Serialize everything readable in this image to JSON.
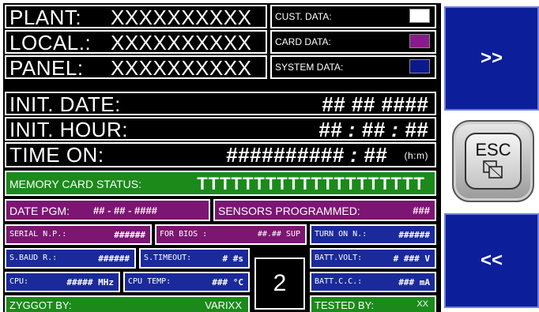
{
  "left": {
    "plant_label": "PLANT:",
    "plant_value": "XXXXXXXXXX",
    "local_label": "LOCAL.:",
    "local_value": "XXXXXXXXXX",
    "panel_label": "PANEL:",
    "panel_value": "XXXXXXXXXX",
    "cust_data_label": "CUST. DATA:",
    "card_data_label": "CARD DATA:",
    "system_data_label": "SYSTEM DATA:",
    "init_date_label": "INIT. DATE:",
    "init_date_value": "##  ##  ####",
    "init_hour_label": "INIT. HOUR:",
    "init_hour_value": "## : ## : ##",
    "time_on_label": "TIME ON:",
    "time_on_value": "########## : ##",
    "time_on_unit": "(h:m)",
    "memory_card_label": "MEMORY CARD STATUS:",
    "memory_card_value": "TTTTTTTTTTTTTTTTTTTT",
    "date_pgm_label": "DATE PGM:",
    "date_pgm_value": "## - ## - ####",
    "sensors_label": "SENSORS PROGRAMMED:",
    "sensors_value": "###",
    "serial_label": "SERIAL N.P.:",
    "serial_value": "######",
    "for_bios_label": "FOR BIOS :",
    "for_bios_value": "##.##  SUP",
    "turn_on_label": "TURN ON N.:",
    "turn_on_value": "######",
    "baud_label": "S.BAUD R.:",
    "baud_value": "######",
    "timeout_label": "S.TIMEOUT:",
    "timeout_value": "# #s",
    "batt_volt_label": "BATT.VOLT:",
    "batt_volt_value": "# ### V",
    "cpu_label": "CPU:",
    "cpu_value": "##### MHz",
    "cpu_temp_label": "CPU TEMP:",
    "cpu_temp_value": "### °C",
    "page_number": "2",
    "batt_cc_label": "BATT.C.C.:",
    "batt_cc_value": "### mA",
    "zyggot_label": "ZYGGOT BY:",
    "zyggot_value": "VARIXX",
    "tested_label": "TESTED BY:",
    "tested_value": "XX"
  },
  "colors": {
    "cust_data": "#ffffff",
    "card_data": "#8a1a8a",
    "system_data": "#0a1a8c"
  },
  "nav": {
    "next_label": ">>",
    "prev_label": "<<",
    "esc_label": "ESC",
    "esc_icon": "copy-window-icon"
  }
}
